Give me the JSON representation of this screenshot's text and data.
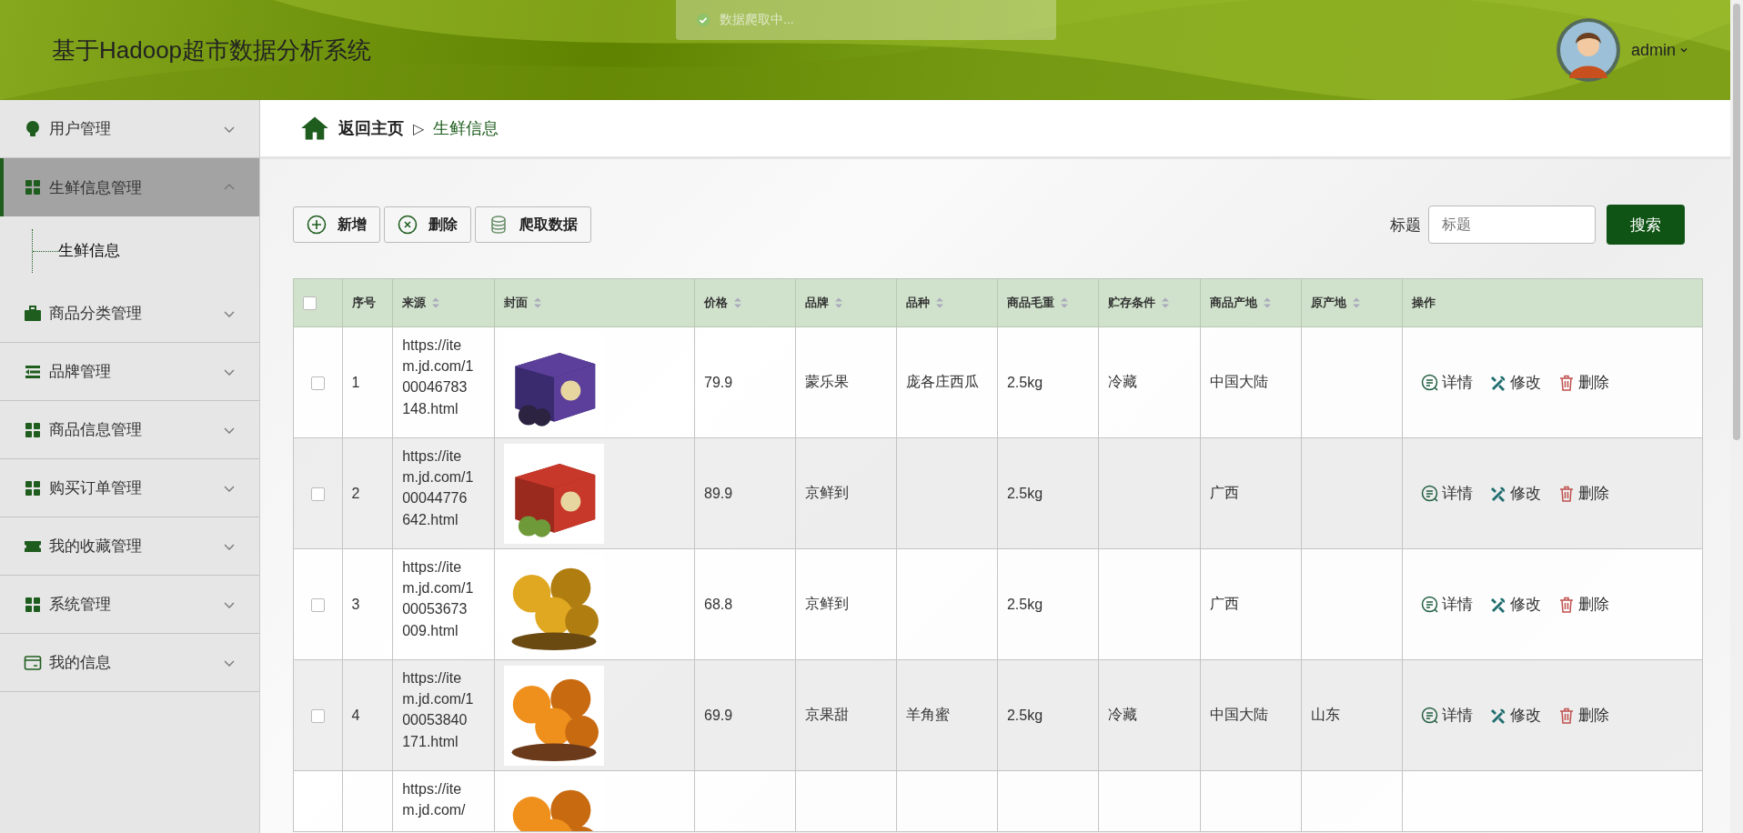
{
  "header": {
    "title": "基于Hadoop超市数据分析系统",
    "toast": "数据爬取中...",
    "user": "admin"
  },
  "sidebar": {
    "items": [
      {
        "label": "用户管理",
        "expanded": false,
        "selected": false
      },
      {
        "label": "生鲜信息管理",
        "expanded": true,
        "selected": true,
        "children": [
          {
            "label": "生鲜信息"
          }
        ]
      },
      {
        "label": "商品分类管理",
        "expanded": false,
        "selected": false
      },
      {
        "label": "品牌管理",
        "expanded": false,
        "selected": false
      },
      {
        "label": "商品信息管理",
        "expanded": false,
        "selected": false
      },
      {
        "label": "购买订单管理",
        "expanded": false,
        "selected": false
      },
      {
        "label": "我的收藏管理",
        "expanded": false,
        "selected": false
      },
      {
        "label": "系统管理",
        "expanded": false,
        "selected": false
      },
      {
        "label": "我的信息",
        "expanded": false,
        "selected": false
      }
    ]
  },
  "breadcrumb": {
    "home": "返回主页",
    "separator": "▷",
    "current": "生鲜信息"
  },
  "toolbar": {
    "buttons": [
      {
        "label": "新增"
      },
      {
        "label": "删除"
      },
      {
        "label": "爬取数据"
      }
    ]
  },
  "search": {
    "label": "标题",
    "placeholder": "标题",
    "button": "搜索"
  },
  "table": {
    "select_all": {
      "checked": false
    },
    "columns": [
      {
        "label": "序号",
        "sortable": false
      },
      {
        "label": "来源",
        "sortable": true
      },
      {
        "label": "封面",
        "sortable": true
      },
      {
        "label": "价格",
        "sortable": true
      },
      {
        "label": "品牌",
        "sortable": true
      },
      {
        "label": "品种",
        "sortable": true
      },
      {
        "label": "商品毛重",
        "sortable": true
      },
      {
        "label": "贮存条件",
        "sortable": true
      },
      {
        "label": "商品产地",
        "sortable": true
      },
      {
        "label": "原产地",
        "sortable": true
      },
      {
        "label": "操作",
        "sortable": false
      }
    ],
    "rows": [
      {
        "checked": false,
        "index": "1",
        "source": "https://item.jd.com/100046783148.html",
        "price": "79.9",
        "brand": "蒙乐果",
        "variety": "庞各庄西瓜",
        "weight": "2.5kg",
        "storage": "冷藏",
        "place": "中国大陆",
        "actions": [
          "详情",
          "修改",
          "删除"
        ]
      },
      {
        "checked": false,
        "index": "2",
        "source": "https://item.jd.com/100044776642.html",
        "price": "89.9",
        "brand": "京鲜到",
        "weight": "2.5kg",
        "place": "广西",
        "actions": [
          "详情",
          "修改",
          "删除"
        ]
      },
      {
        "checked": false,
        "index": "3",
        "source": "https://item.jd.com/100053673009.html",
        "price": "68.8",
        "brand": "京鲜到",
        "weight": "2.5kg",
        "place": "广西",
        "actions": [
          "详情",
          "修改",
          "删除"
        ]
      },
      {
        "checked": false,
        "index": "4",
        "source": "https://item.jd.com/100053840171.html",
        "price": "69.9",
        "brand": "京果甜",
        "variety": "羊角蜜",
        "weight": "2.5kg",
        "storage": "冷藏",
        "place": "中国大陆",
        "origin": "山东",
        "actions": [
          "详情",
          "修改",
          "删除"
        ]
      },
      {
        "source": "https://item.jd.com/"
      }
    ]
  }
}
